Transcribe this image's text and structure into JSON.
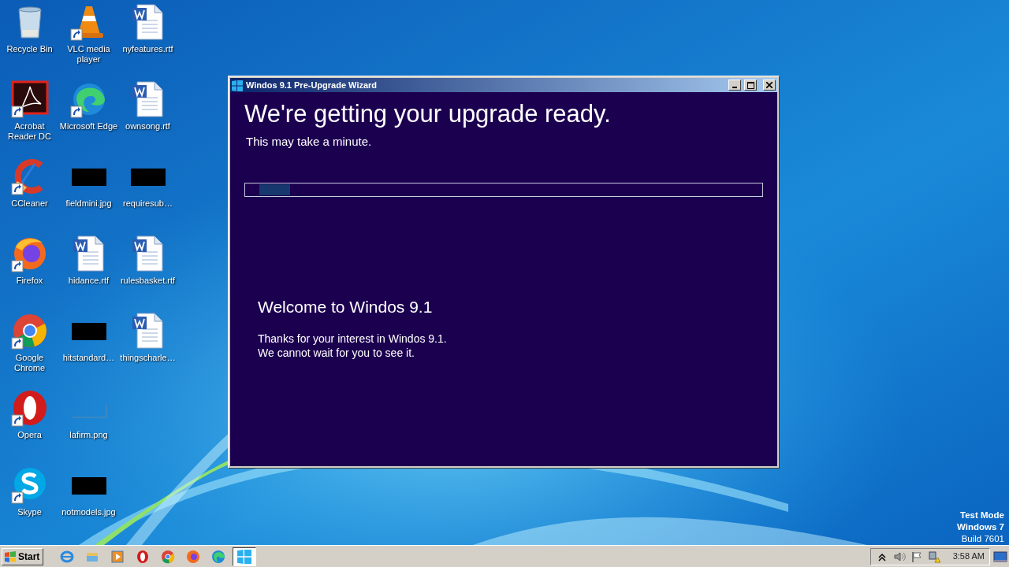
{
  "desktop": {
    "columns": [
      {
        "items": [
          {
            "label": "Recycle Bin",
            "kind": "recycle",
            "shortcut": false
          },
          {
            "label": "Acrobat Reader DC",
            "kind": "acrobat",
            "shortcut": true
          },
          {
            "label": "CCleaner",
            "kind": "ccleaner",
            "shortcut": true
          },
          {
            "label": "Firefox",
            "kind": "firefox",
            "shortcut": true
          },
          {
            "label": "Google Chrome",
            "kind": "chrome",
            "shortcut": true
          },
          {
            "label": "Opera",
            "kind": "opera",
            "shortcut": true
          },
          {
            "label": "Skype",
            "kind": "skype",
            "shortcut": true
          }
        ]
      },
      {
        "items": [
          {
            "label": "VLC media player",
            "kind": "vlc",
            "shortcut": true
          },
          {
            "label": "Microsoft Edge",
            "kind": "edge",
            "shortcut": true
          },
          {
            "label": "fieldmini.jpg",
            "kind": "thumbnail",
            "shortcut": false
          },
          {
            "label": "hidance.rtf",
            "kind": "document",
            "shortcut": false
          },
          {
            "label": "hitstandard…",
            "kind": "thumbnail",
            "shortcut": false
          },
          {
            "label": "lafirm.png",
            "kind": "blank",
            "shortcut": false
          },
          {
            "label": "notmodels.jpg",
            "kind": "thumbnail",
            "shortcut": false
          }
        ]
      },
      {
        "items": [
          {
            "label": "nyfeatures.rtf",
            "kind": "document",
            "shortcut": false
          },
          {
            "label": "ownsong.rtf",
            "kind": "document",
            "shortcut": false
          },
          {
            "label": "requiresub…",
            "kind": "thumbnail",
            "shortcut": false
          },
          {
            "label": "rulesbasket.rtf",
            "kind": "document",
            "shortcut": false
          },
          {
            "label": "thingscharle…",
            "kind": "document",
            "shortcut": false
          }
        ]
      }
    ]
  },
  "window": {
    "title": "Windos 9.1 Pre-Upgrade Wizard",
    "heading": "We're getting your upgrade ready.",
    "subheading": "This may take a minute.",
    "progress": {
      "marquee": true
    },
    "welcome_title": "Welcome to Windos 9.1",
    "welcome_lines": [
      "Thanks for your interest in Windos 9.1.",
      "We cannot wait for you to see it."
    ]
  },
  "watermark_text": [
    "Test Mode",
    "Windows 7",
    "Build 7601"
  ],
  "taskbar": {
    "start": "Start",
    "quick_launch": [
      {
        "kind": "ie"
      },
      {
        "kind": "explorer"
      },
      {
        "kind": "player"
      },
      {
        "kind": "opera"
      },
      {
        "kind": "chrome"
      },
      {
        "kind": "firefox"
      },
      {
        "kind": "edge"
      }
    ],
    "tasks": [
      {
        "kind": "wizard",
        "selected": true
      }
    ],
    "tray": [
      {
        "kind": "chevron"
      },
      {
        "kind": "volume"
      },
      {
        "kind": "flag"
      },
      {
        "kind": "network"
      }
    ],
    "clock": "3:58 AM"
  }
}
